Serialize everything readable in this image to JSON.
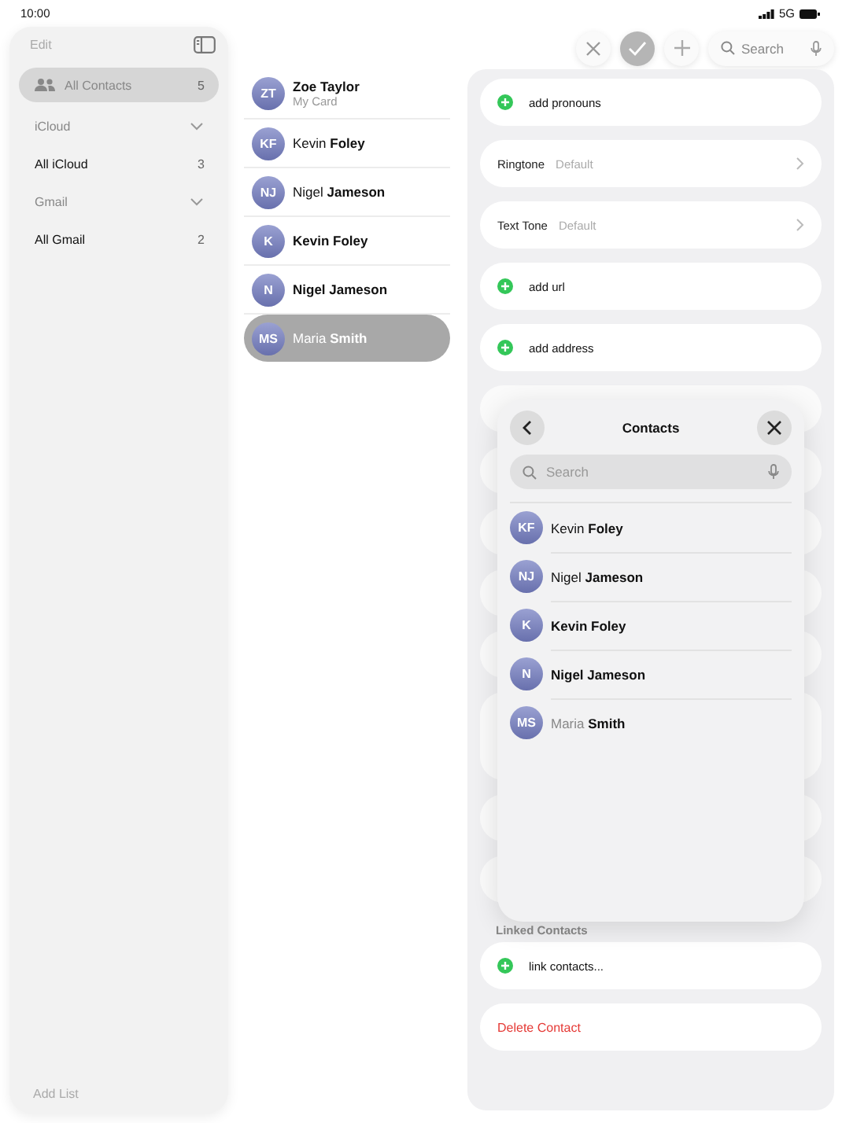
{
  "status_bar": {
    "time": "10:00",
    "network": "5G"
  },
  "sidebar": {
    "edit": "Edit",
    "items": [
      {
        "kind": "list",
        "label": "All Contacts",
        "count": "5",
        "selected": true
      },
      {
        "kind": "section",
        "label": "iCloud"
      },
      {
        "kind": "list",
        "label": "All iCloud",
        "count": "3",
        "selected": false
      },
      {
        "kind": "section",
        "label": "Gmail"
      },
      {
        "kind": "list",
        "label": "All Gmail",
        "count": "2",
        "selected": false
      }
    ],
    "add_list": "Add List"
  },
  "toolbar": {
    "search": {
      "placeholder": "Search"
    }
  },
  "contacts": [
    {
      "initials": "ZT",
      "first": "Zoe",
      "last": "Taylor",
      "bold_first": true,
      "subtitle": "My Card",
      "dimmed": false,
      "selected": false
    },
    {
      "initials": "KF",
      "first": "Kevin",
      "last": "Foley",
      "bold_first": false,
      "dimmed": false,
      "selected": false
    },
    {
      "initials": "NJ",
      "first": "Nigel",
      "last": "Jameson",
      "bold_first": false,
      "dimmed": false,
      "selected": false
    },
    {
      "initials": "K",
      "first": "Kevin",
      "last": "Foley",
      "bold_first": true,
      "dimmed": false,
      "selected": false
    },
    {
      "initials": "N",
      "first": "Nigel",
      "last": "Jameson",
      "bold_first": true,
      "dimmed": false,
      "selected": false
    },
    {
      "initials": "MS",
      "first": "Maria",
      "last": "Smith",
      "bold_first": false,
      "dimmed": true,
      "selected": true
    }
  ],
  "detail": {
    "rows": [
      {
        "kind": "add",
        "label": "add pronouns"
      },
      {
        "kind": "setting",
        "label": "Ringtone",
        "value": "Default"
      },
      {
        "kind": "setting",
        "label": "Text Tone",
        "value": "Default"
      },
      {
        "kind": "add",
        "label": "add url"
      },
      {
        "kind": "add",
        "label": "add address"
      }
    ],
    "linked_header": "Linked Contacts",
    "link_row": {
      "kind": "add",
      "label": "link contacts..."
    },
    "delete": "Delete Contact"
  },
  "picker": {
    "title": "Contacts",
    "search": {
      "placeholder": "Search"
    },
    "contacts": [
      {
        "initials": "KF",
        "first": "Kevin",
        "last": "Foley",
        "bold_first": false,
        "dimmed": false
      },
      {
        "initials": "NJ",
        "first": "Nigel",
        "last": "Jameson",
        "bold_first": false,
        "dimmed": false
      },
      {
        "initials": "K",
        "first": "Kevin",
        "last": "Foley",
        "bold_first": true,
        "dimmed": false
      },
      {
        "initials": "N",
        "first": "Nigel",
        "last": "Jameson",
        "bold_first": true,
        "dimmed": false
      },
      {
        "initials": "MS",
        "first": "Maria",
        "last": "Smith",
        "bold_first": false,
        "dimmed": true
      }
    ]
  }
}
